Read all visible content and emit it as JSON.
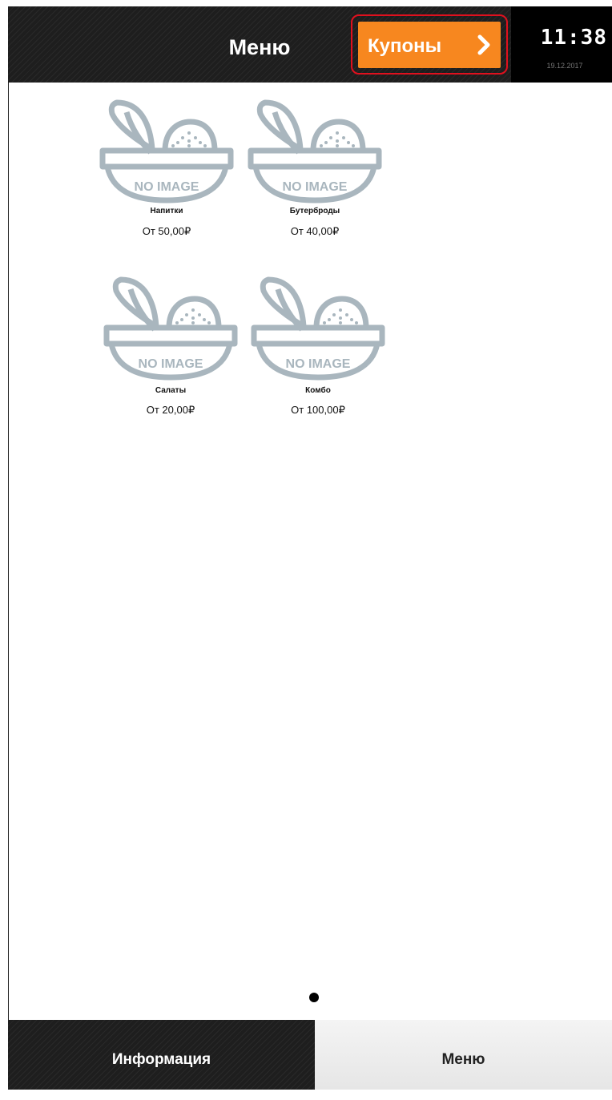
{
  "header": {
    "title": "Меню",
    "coupon_button": "Купоны"
  },
  "clock": {
    "time": "11:38",
    "date": "19.12.2017"
  },
  "placeholder_text": "NO IMAGE",
  "categories": [
    {
      "name": "Напитки",
      "price": "От 50,00₽"
    },
    {
      "name": "Бутерброды",
      "price": "От 40,00₽"
    },
    {
      "name": "Салаты",
      "price": "От 20,00₽"
    },
    {
      "name": "Комбо",
      "price": "От 100,00₽"
    }
  ],
  "pagination": {
    "current_page": 1,
    "total_pages": 1
  },
  "bottom_nav": {
    "info_label": "Информация",
    "menu_label": "Меню"
  },
  "colors": {
    "accent": "#f7871f",
    "header_bg": "#1e1e1e",
    "highlight_outline": "#e0101e",
    "placeholder": "#a9b6be"
  }
}
